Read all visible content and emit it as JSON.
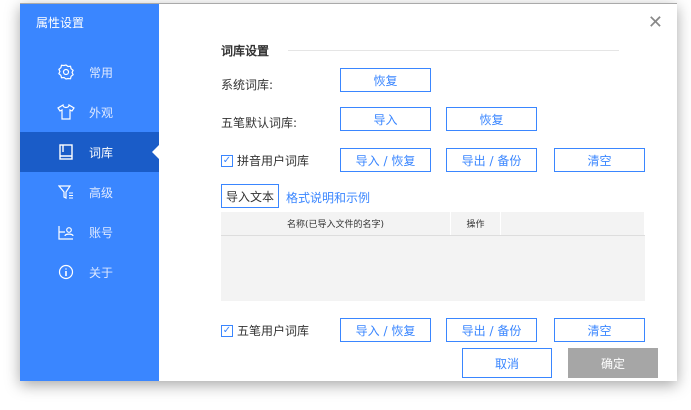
{
  "window": {
    "title": "属性设置",
    "close": "✕"
  },
  "sidebar": {
    "items": [
      {
        "label": "常用",
        "icon": "gear-icon"
      },
      {
        "label": "外观",
        "icon": "shirt-icon"
      },
      {
        "label": "词库",
        "icon": "book-icon",
        "active": true
      },
      {
        "label": "高级",
        "icon": "filter-icon"
      },
      {
        "label": "账号",
        "icon": "account-icon"
      },
      {
        "label": "关于",
        "icon": "info-icon"
      }
    ]
  },
  "main": {
    "section_title": "词库设置",
    "system_dict": {
      "label": "系统词库:",
      "restore": "恢复"
    },
    "wubi_default": {
      "label": "五笔默认词库:",
      "import": "导入",
      "restore": "恢复"
    },
    "pinyin_user": {
      "label": "拼音用户词库",
      "checked": true,
      "import_restore": "导入 / 恢复",
      "export_backup": "导出 / 备份",
      "clear": "清空"
    },
    "import_text": "导入文本",
    "format_link": "格式说明和示例",
    "table": {
      "columns": [
        "名称(已导入文件的名字)",
        "操作",
        ""
      ]
    },
    "wubi_user": {
      "label": "五笔用户词库",
      "checked": true,
      "import_restore": "导入 / 恢复",
      "export_backup": "导出 / 备份",
      "clear": "清空"
    },
    "cancel": "取消",
    "ok": "确定"
  }
}
